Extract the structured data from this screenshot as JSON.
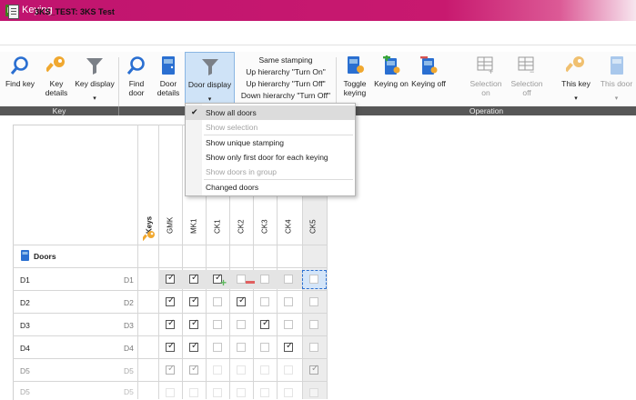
{
  "window": {
    "title": "Keying",
    "app_logo": "Ls"
  },
  "document": {
    "title": "3KS_TEST: 3KS Test"
  },
  "ribbon": {
    "key_group": {
      "label": "Key",
      "find_key": "Find key",
      "key_details": "Key\ndetails",
      "key_display": "Key display"
    },
    "door_group": {
      "label": "Door",
      "find_door": "Find\ndoor",
      "door_details": "Door\ndetails",
      "door_display": "Door display"
    },
    "stamping": {
      "same": "Same stamping",
      "up_on": "Up hierarchy \"Turn On\"",
      "up_off": "Up hierarchy \"Turn Off\"",
      "down_off": "Down hierarchy \"Turn Off\""
    },
    "operation_group": {
      "label": "Operation",
      "toggle_keying": "Toggle\nkeying",
      "keying_on": "Keying on",
      "keying_off": "Keying off",
      "selection_on": "Selection\non",
      "selection_off": "Selection\noff",
      "this_key": "This key",
      "this_door": "This door"
    }
  },
  "door_display_menu": {
    "items": [
      {
        "label": "Show all doors",
        "checked": true,
        "enabled": true
      },
      {
        "label": "Show selection",
        "checked": false,
        "enabled": false
      },
      {
        "label": "Show unique stamping",
        "checked": false,
        "enabled": true
      },
      {
        "label": "Show only first door for each keying",
        "checked": false,
        "enabled": true
      },
      {
        "label": "Show doors in group",
        "checked": false,
        "enabled": false
      },
      {
        "label": "Changed doors",
        "checked": false,
        "enabled": true
      }
    ]
  },
  "grid": {
    "keys_header": "Keys",
    "columns": [
      "GMK",
      "MK1",
      "CK1",
      "CK2",
      "CK3",
      "CK4",
      "CK5"
    ],
    "doors_header": "Doors",
    "rows": [
      {
        "name": "D1",
        "code": "D1",
        "cells": [
          true,
          true,
          true,
          false,
          false,
          false,
          false
        ]
      },
      {
        "name": "D2",
        "code": "D2",
        "cells": [
          true,
          true,
          false,
          true,
          false,
          false,
          false
        ]
      },
      {
        "name": "D3",
        "code": "D3",
        "cells": [
          true,
          true,
          false,
          false,
          true,
          false,
          false
        ]
      },
      {
        "name": "D4",
        "code": "D4",
        "cells": [
          true,
          true,
          false,
          false,
          false,
          true,
          false
        ]
      },
      {
        "name": "D5",
        "code": "D5",
        "cells": [
          true,
          true,
          false,
          false,
          false,
          false,
          true
        ]
      },
      {
        "name": "D5",
        "code": "D5",
        "cells": [
          false,
          false,
          false,
          false,
          false,
          false,
          false
        ]
      }
    ]
  },
  "colors": {
    "title_bar": "#c0146f",
    "accent_blue": "#2a6fd1",
    "add_green": "#5cb85c",
    "remove_red": "#e06060"
  }
}
